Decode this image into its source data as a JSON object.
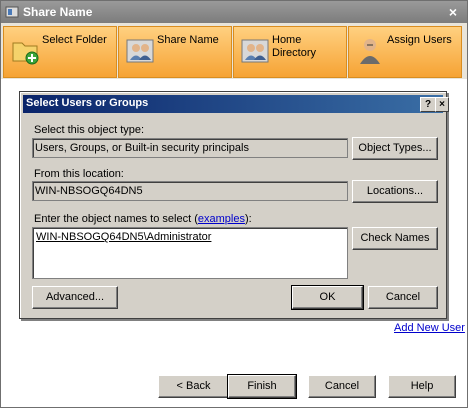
{
  "window": {
    "title": "Share Name",
    "close_glyph": "×"
  },
  "wizard_steps": [
    {
      "label": "Select Folder",
      "icon": "folder-add-icon"
    },
    {
      "label": "Share Name",
      "icon": "users-icon"
    },
    {
      "label": "Home Directory",
      "icon": "users-icon"
    },
    {
      "label": "Assign Users",
      "icon": "user-icon"
    }
  ],
  "add_new_user_link": "Add New User",
  "footer": {
    "back": "< Back",
    "finish": "Finish",
    "cancel": "Cancel",
    "help": "Help"
  },
  "dialog": {
    "title": "Select Users or Groups",
    "help_glyph": "?",
    "close_glyph": "×",
    "object_type_label": "Select this object type:",
    "object_type_value": "Users, Groups, or Built-in security principals",
    "object_types_button": "Object Types...",
    "location_label": "From this location:",
    "location_value": "WIN-NBSOGQ64DN5",
    "locations_button": "Locations...",
    "names_label_prefix": "Enter the object names to select (",
    "names_label_link": "examples",
    "names_label_suffix": "):",
    "names_value": "WIN-NBSOGQ64DN5\\Administrator",
    "check_names_button": "Check Names",
    "advanced_button": "Advanced...",
    "ok_button": "OK",
    "cancel_button": "Cancel"
  },
  "colors": {
    "step_orange": "#f6a334",
    "dialog_title_blue": "#0a246a",
    "link_blue": "#0000cc"
  }
}
